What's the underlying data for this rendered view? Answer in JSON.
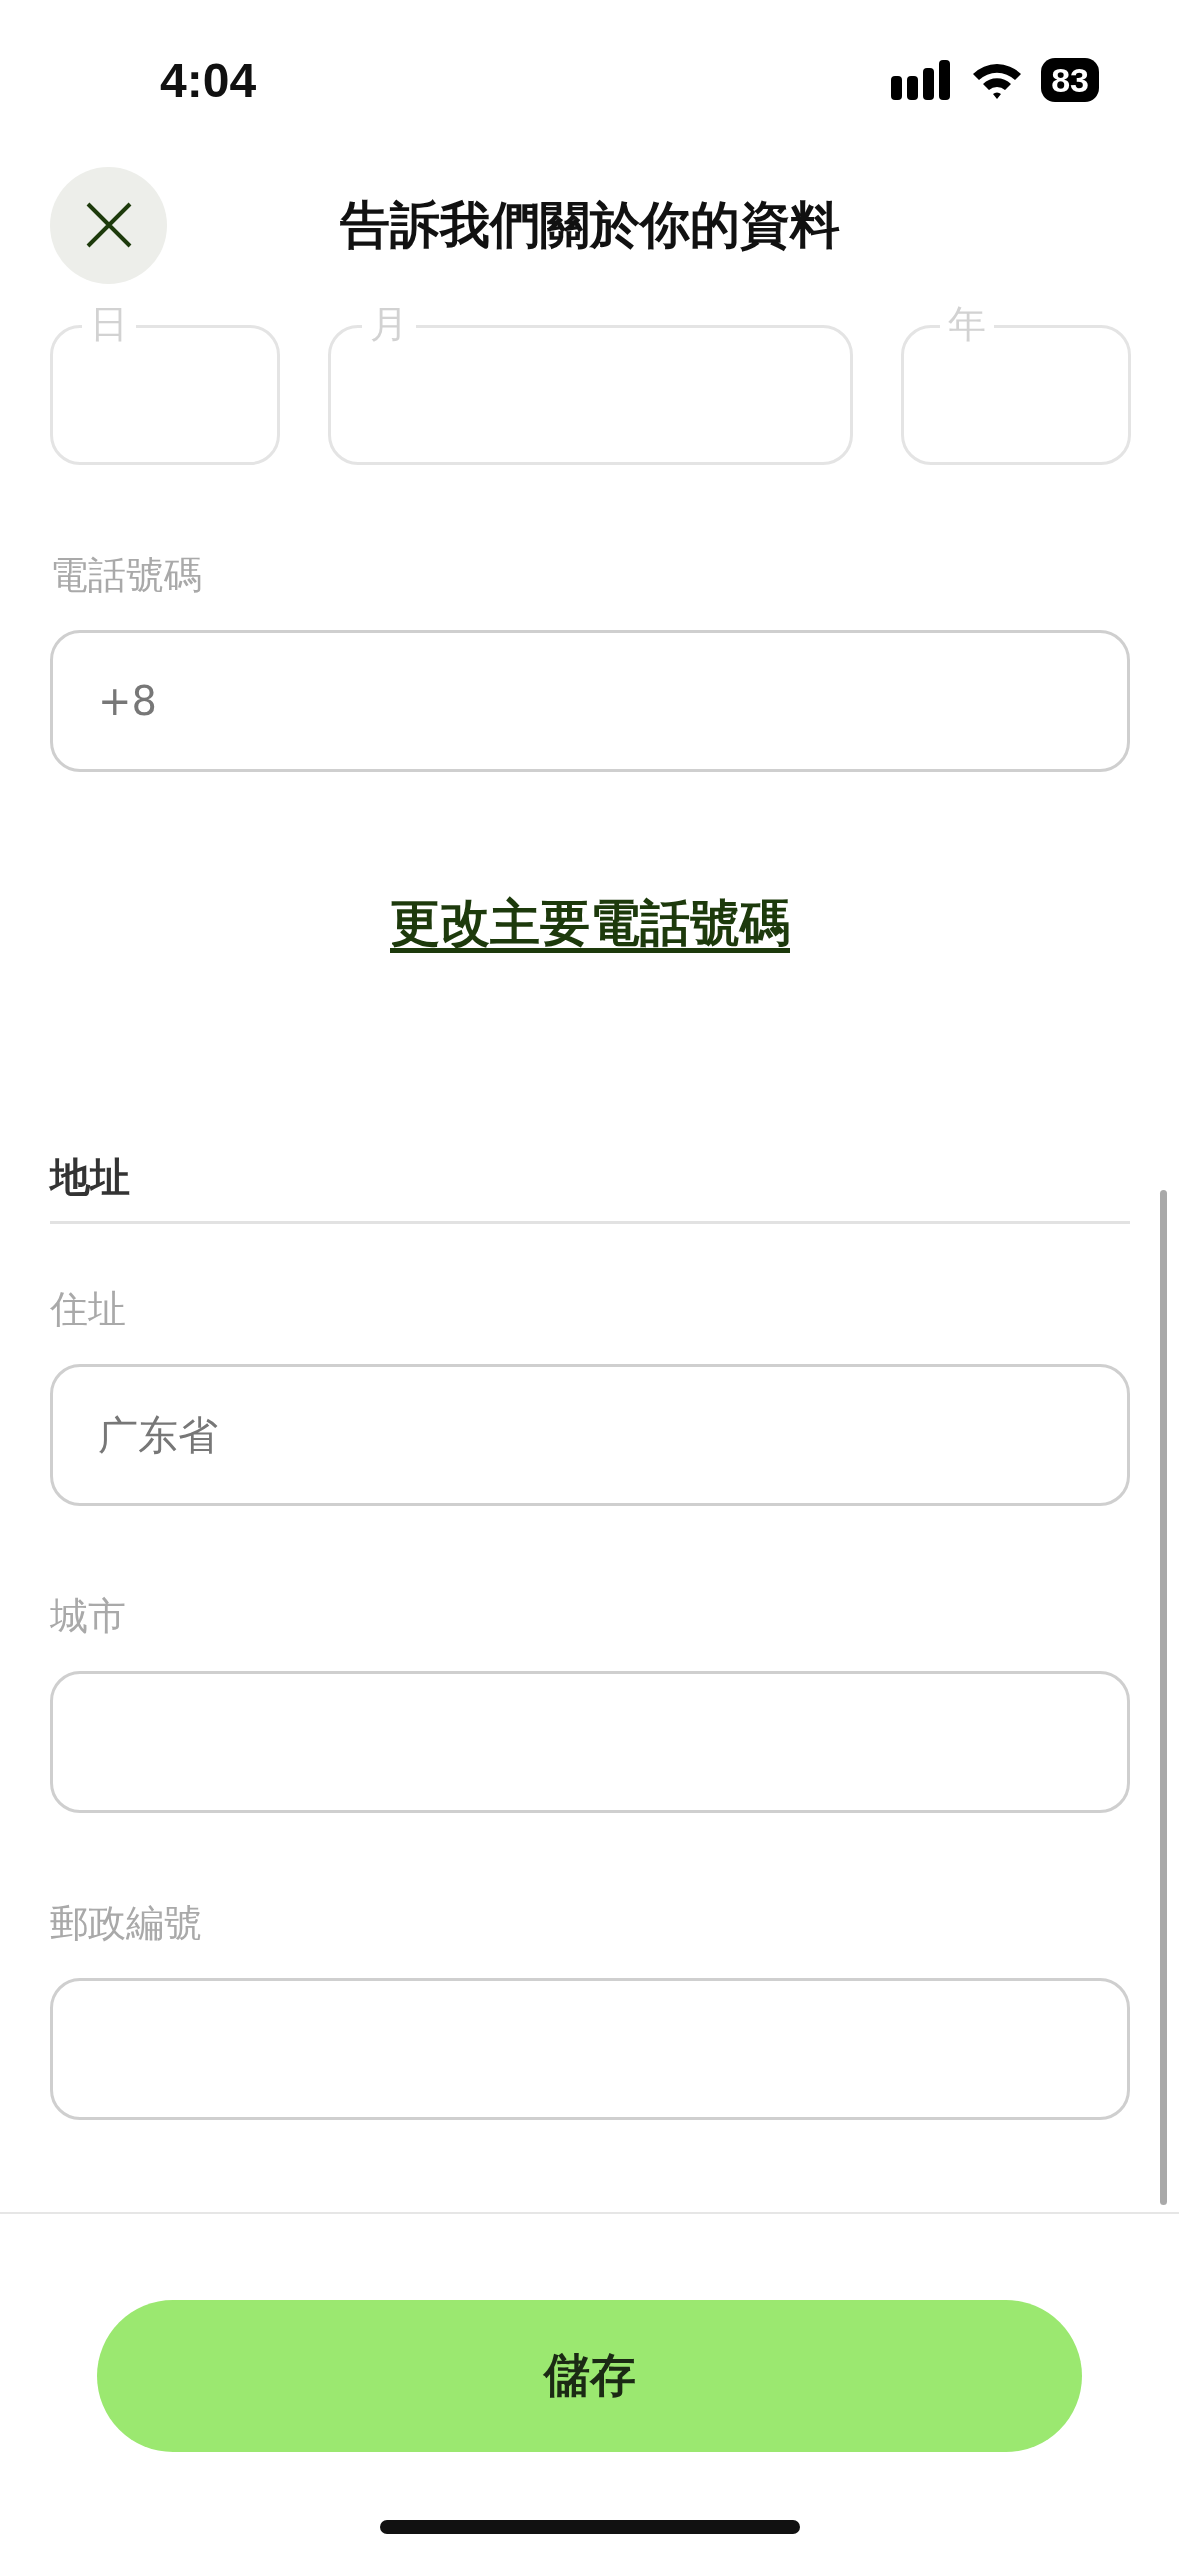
{
  "status_bar": {
    "time": "4:04",
    "battery": "83"
  },
  "header": {
    "title": "告訴我們關於你的資料"
  },
  "date_fields": [
    {
      "label": "日"
    },
    {
      "label": "月"
    },
    {
      "label": "年"
    }
  ],
  "phone": {
    "label": "電話號碼",
    "value": "+8"
  },
  "change_phone_link": "更改主要電話號碼",
  "address_section": {
    "title": "地址",
    "fields": [
      {
        "label": "住址",
        "value": "广东省"
      },
      {
        "label": "城市"
      },
      {
        "label": "郵政編號"
      }
    ]
  },
  "save_button": "儲存"
}
